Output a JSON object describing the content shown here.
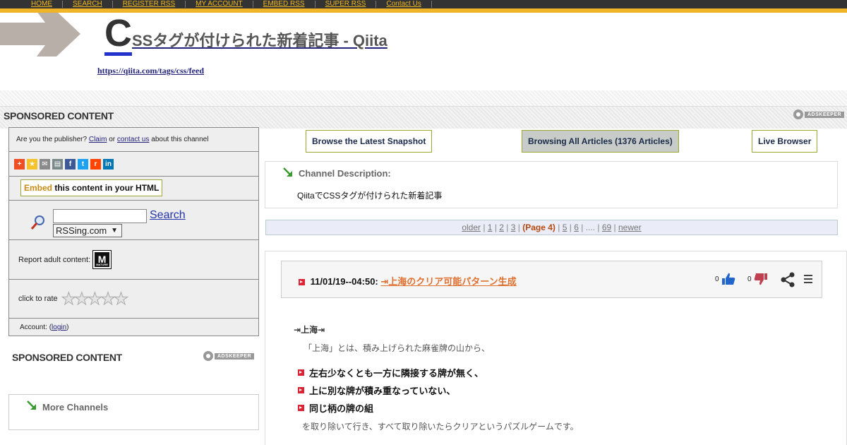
{
  "nav": [
    "HOME",
    "SEARCH",
    "REGISTER RSS",
    "MY ACCOUNT",
    "EMBED RSS",
    "SUPER RSS",
    "Contact Us"
  ],
  "header": {
    "title_first": "C",
    "title_rest": "SSタグが付けられた新着記事 - Qiita",
    "feed_url": "https://qiita.com/tags/css/feed"
  },
  "sponsored": {
    "label": "SPONSORED CONTENT",
    "adskeeper": "ADSKEEPER"
  },
  "left": {
    "publisher_prefix": "Are you the publisher?",
    "claim": "Claim",
    "or": "or",
    "contact": "contact us",
    "publisher_suffix": "about this channel",
    "embed_em": "Embed",
    "embed_rest": "this content in your HTML",
    "search_label": "Search",
    "search_select": "RSSing.com",
    "adult_label": "Report adult content:",
    "mature_badge": "M",
    "mature_small": "MATURE",
    "rate_label": "click to rate",
    "account_prefix": "Account: (",
    "account_link": "login",
    "account_suffix": ")",
    "more_channels": "More Channels"
  },
  "buttons": {
    "latest": "Browse the Latest Snapshot",
    "all": "Browsing All Articles (1376 Articles)",
    "live": "Live Browser"
  },
  "channel": {
    "label": "Channel Description:",
    "text": "QiitaでCSSタグが付けられた新着記事"
  },
  "pager": {
    "older": "older",
    "p1": "1",
    "p2": "2",
    "p3": "3",
    "current": "(Page 4)",
    "p5": "5",
    "p6": "6",
    "dots": "....",
    "p69": "69",
    "newer": "newer"
  },
  "article": {
    "date": "11/01/19--04:50:",
    "title": "上海のクリア可能パターン生成",
    "up_count": "0",
    "down_count": "0",
    "heading": "上海",
    "intro": "「上海」とは、積み上げられた麻雀牌の山から、",
    "bullets": [
      "左右少なくとも一方に隣接する牌が無く、",
      "上に別な牌が積み重なっていない、",
      "同じ柄の牌の組"
    ],
    "outro": "を取り除いて行き、すべて取り除いたらクリアというパズルゲームです。"
  },
  "colors": {
    "gold": "#f0b429",
    "accent_blue": "#2233cc",
    "link_orange": "#e07030",
    "green_border": "#9aa832"
  }
}
